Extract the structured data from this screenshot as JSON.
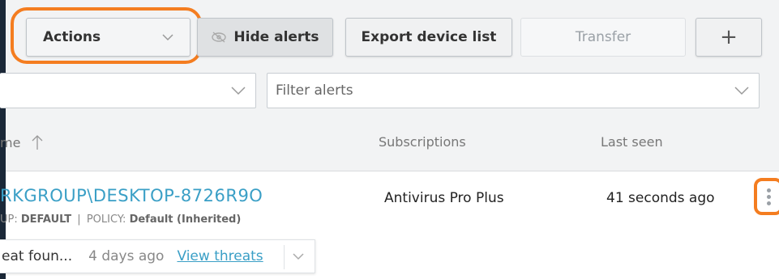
{
  "toolbar": {
    "actions_label": "Actions",
    "hide_alerts_label": "Hide alerts",
    "export_label": "Export device list",
    "transfer_label": "Transfer",
    "add_label": "+"
  },
  "filters": {
    "left_value": "",
    "alerts_placeholder": "Filter alerts"
  },
  "columns": {
    "name": "me",
    "subscriptions": "Subscriptions",
    "last_seen": "Last seen"
  },
  "device": {
    "name": "RKGROUP\\DESKTOP-8726R9O",
    "group_prefix": "UP:",
    "group_value": "DEFAULT",
    "separator": "|",
    "policy_prefix": "POLICY:",
    "policy_value": "Default (Inherited)",
    "subscription": "Antivirus Pro Plus",
    "last_seen": "41 seconds ago"
  },
  "alert": {
    "text": "eat foun...",
    "time": "4 days ago",
    "link": "View threats"
  },
  "colors": {
    "highlight": "#f47d20",
    "link": "#3a9fc6"
  }
}
